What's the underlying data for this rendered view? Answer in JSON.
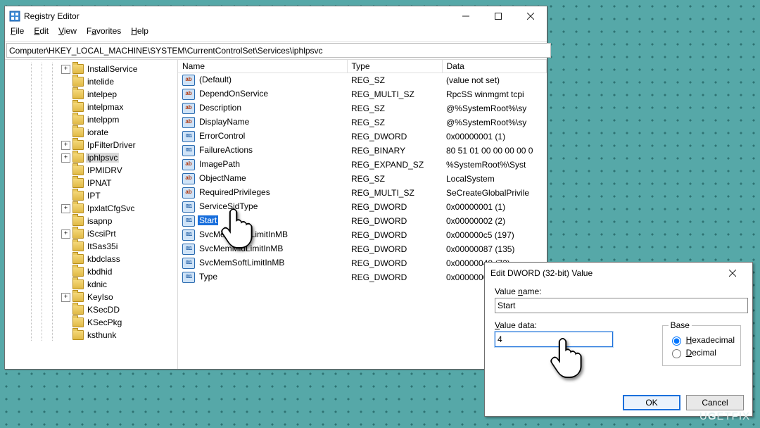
{
  "window": {
    "title": "Registry Editor",
    "menu": {
      "file": "File",
      "edit": "Edit",
      "view": "View",
      "favorites": "Favorites",
      "help": "Help"
    },
    "address": "Computer\\HKEY_LOCAL_MACHINE\\SYSTEM\\CurrentControlSet\\Services\\iphlpsvc"
  },
  "tree": {
    "selected": "iphlpsvc",
    "items": [
      {
        "label": "InstallService",
        "exp": true
      },
      {
        "label": "intelide"
      },
      {
        "label": "intelpep"
      },
      {
        "label": "intelpmax"
      },
      {
        "label": "intelppm"
      },
      {
        "label": "iorate"
      },
      {
        "label": "IpFilterDriver",
        "exp": true
      },
      {
        "label": "iphlpsvc",
        "exp": true,
        "selected": true
      },
      {
        "label": "IPMIDRV"
      },
      {
        "label": "IPNAT"
      },
      {
        "label": "IPT"
      },
      {
        "label": "IpxlatCfgSvc",
        "exp": true
      },
      {
        "label": "isapnp"
      },
      {
        "label": "iScsiPrt",
        "exp": true
      },
      {
        "label": "ItSas35i"
      },
      {
        "label": "kbdclass"
      },
      {
        "label": "kbdhid"
      },
      {
        "label": "kdnic"
      },
      {
        "label": "KeyIso",
        "exp": true
      },
      {
        "label": "KSecDD"
      },
      {
        "label": "KSecPkg"
      },
      {
        "label": "ksthunk"
      }
    ]
  },
  "list": {
    "columns": {
      "name": "Name",
      "type": "Type",
      "data": "Data"
    },
    "rows": [
      {
        "icon": "ab",
        "name": "(Default)",
        "type": "REG_SZ",
        "data": "(value not set)"
      },
      {
        "icon": "ab",
        "name": "DependOnService",
        "type": "REG_MULTI_SZ",
        "data": "RpcSS winmgmt tcpi"
      },
      {
        "icon": "ab",
        "name": "Description",
        "type": "REG_SZ",
        "data": "@%SystemRoot%\\sy"
      },
      {
        "icon": "ab",
        "name": "DisplayName",
        "type": "REG_SZ",
        "data": "@%SystemRoot%\\sy"
      },
      {
        "icon": "nn",
        "name": "ErrorControl",
        "type": "REG_DWORD",
        "data": "0x00000001 (1)"
      },
      {
        "icon": "nn",
        "name": "FailureActions",
        "type": "REG_BINARY",
        "data": "80 51 01 00 00 00 00 0"
      },
      {
        "icon": "ab",
        "name": "ImagePath",
        "type": "REG_EXPAND_SZ",
        "data": "%SystemRoot%\\Syst"
      },
      {
        "icon": "ab",
        "name": "ObjectName",
        "type": "REG_SZ",
        "data": "LocalSystem"
      },
      {
        "icon": "ab",
        "name": "RequiredPrivileges",
        "type": "REG_MULTI_SZ",
        "data": "SeCreateGlobalPrivile"
      },
      {
        "icon": "nn",
        "name": "ServiceSidType",
        "type": "REG_DWORD",
        "data": "0x00000001 (1)"
      },
      {
        "icon": "nn",
        "name": "Start",
        "type": "REG_DWORD",
        "data": "0x00000002 (2)",
        "selected": true
      },
      {
        "icon": "nn",
        "name": "SvcMemHardLimitInMB",
        "type": "REG_DWORD",
        "data": "0x000000c5 (197)"
      },
      {
        "icon": "nn",
        "name": "SvcMemMidLimitInMB",
        "type": "REG_DWORD",
        "data": "0x00000087 (135)"
      },
      {
        "icon": "nn",
        "name": "SvcMemSoftLimitInMB",
        "type": "REG_DWORD",
        "data": "0x00000048 (72)"
      },
      {
        "icon": "nn",
        "name": "Type",
        "type": "REG_DWORD",
        "data": "0x0000000"
      }
    ]
  },
  "dialog": {
    "title": "Edit DWORD (32-bit) Value",
    "valueNameLabel": "Value name:",
    "valueName": "Start",
    "valueDataLabel": "Value data:",
    "valueData": "4",
    "baseLabel": "Base",
    "hex": "Hexadecimal",
    "dec": "Decimal",
    "ok": "OK",
    "cancel": "Cancel",
    "baseSelected": "hex"
  },
  "watermark": "UGETFIX"
}
